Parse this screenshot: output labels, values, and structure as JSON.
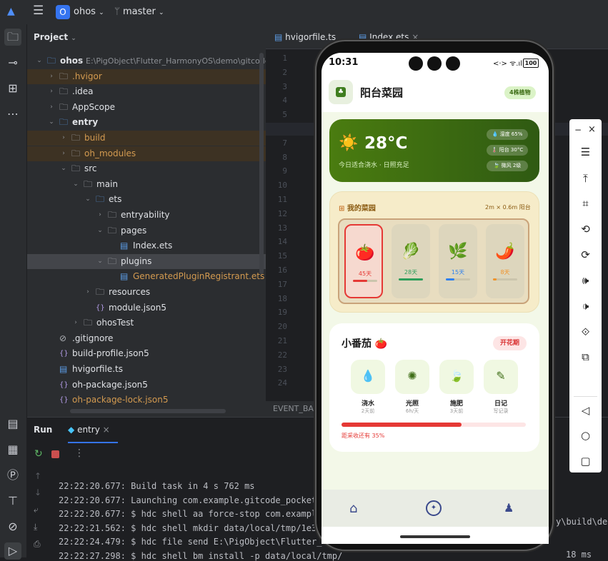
{
  "topbar": {
    "project_badge": "O",
    "project_name": "ohos",
    "branch": "master"
  },
  "project_panel": {
    "title": "Project",
    "tree": [
      {
        "label": "ohos",
        "suffix": "E:\\PigObject\\Flutter_HarmonyOS\\demo\\gitcode_p",
        "depth": 0,
        "icon": "module-folder-icon",
        "expanded": true,
        "bold": true
      },
      {
        "label": ".hvigor",
        "depth": 1,
        "icon": "folder-icon",
        "expanded": false,
        "excluded": true
      },
      {
        "label": ".idea",
        "depth": 1,
        "icon": "folder-icon",
        "expanded": false
      },
      {
        "label": "AppScope",
        "depth": 1,
        "icon": "folder-icon",
        "expanded": false
      },
      {
        "label": "entry",
        "depth": 1,
        "icon": "module-folder-icon",
        "expanded": true,
        "bold": true
      },
      {
        "label": "build",
        "depth": 2,
        "icon": "folder-icon",
        "expanded": false,
        "excluded": true
      },
      {
        "label": "oh_modules",
        "depth": 2,
        "icon": "folder-icon",
        "expanded": false,
        "excluded": true
      },
      {
        "label": "src",
        "depth": 2,
        "icon": "folder-icon",
        "expanded": true
      },
      {
        "label": "main",
        "depth": 3,
        "icon": "folder-icon",
        "expanded": true
      },
      {
        "label": "ets",
        "depth": 4,
        "icon": "source-folder-icon",
        "expanded": true
      },
      {
        "label": "entryability",
        "depth": 5,
        "icon": "folder-icon",
        "expanded": false
      },
      {
        "label": "pages",
        "depth": 5,
        "icon": "folder-icon",
        "expanded": true
      },
      {
        "label": "Index.ets",
        "depth": 6,
        "icon": "ets-file-icon",
        "leaf": true
      },
      {
        "label": "plugins",
        "depth": 5,
        "icon": "folder-icon",
        "expanded": true,
        "selected": true
      },
      {
        "label": "GeneratedPluginRegistrant.ets",
        "depth": 6,
        "icon": "ets-file-icon",
        "leaf": true,
        "orange": true
      },
      {
        "label": "resources",
        "depth": 4,
        "icon": "folder-icon",
        "expanded": false
      },
      {
        "label": "module.json5",
        "depth": 4,
        "icon": "json-file-icon",
        "leaf": true
      },
      {
        "label": "ohosTest",
        "depth": 3,
        "icon": "folder-icon",
        "expanded": false
      },
      {
        "label": ".gitignore",
        "depth": 1,
        "icon": "ignore-file-icon",
        "leaf": true
      },
      {
        "label": "build-profile.json5",
        "depth": 1,
        "icon": "json-file-icon",
        "leaf": true
      },
      {
        "label": "hvigorfile.ts",
        "depth": 1,
        "icon": "ts-file-icon",
        "leaf": true
      },
      {
        "label": "oh-package.json5",
        "depth": 1,
        "icon": "json-file-icon",
        "leaf": true
      },
      {
        "label": "oh-package-lock.json5",
        "depth": 1,
        "icon": "json-file-icon",
        "leaf": true,
        "orange": true
      }
    ]
  },
  "editor": {
    "tabs": [
      {
        "label": "hvigorfile.ts"
      },
      {
        "label": "Index.ets"
      }
    ],
    "line_numbers": [
      "1",
      "2",
      "3",
      "4",
      "5",
      "6",
      "7",
      "8",
      "9",
      "10",
      "11",
      "12",
      "13",
      "14",
      "15",
      "16",
      "17",
      "18",
      "19",
      "20",
      "21",
      "22",
      "23",
      "24"
    ],
    "bottom_tab": "EVENT_BAC"
  },
  "run_panel": {
    "title": "Run",
    "config": "entry",
    "logs": [
      "22:22:20.677: Build task in 4 s 762 ms",
      "22:22:20.677: Launching com.example.gitcode_pocket",
      "22:22:20.677: $ hdc shell aa force-stop com.exampl",
      "22:22:21.562: $ hdc shell mkdir data/local/tmp/1e3",
      "22:22:24.479: $ hdc file send E:\\PigObject\\Flutter_",
      "22:22:27.298: $ hdc shell bm install -p data/local/tmp/"
    ],
    "right_fragment": "y\\build\\defa",
    "right_fragment2": "18 ms"
  },
  "phone": {
    "status": {
      "time": "10:31",
      "signal": "<·> ᯤ.ıll",
      "battery": "100"
    },
    "app": {
      "title": "阳台菜园",
      "badge": "4株植物",
      "weather": {
        "icon": "☀️",
        "temp": "28°C",
        "subtitle": "今日适合浇水 · 日照充足",
        "chips": [
          "💧 湿度 65%",
          "🌡️ 阳台 30°C",
          "🍃 微风 2级"
        ]
      },
      "garden": {
        "title": "我的菜园",
        "size": "2m × 0.6m 阳台",
        "plots": [
          {
            "emoji": "🍅",
            "days": "45天",
            "progress": 0.6,
            "color": "#e53935",
            "selected": true
          },
          {
            "emoji": "🥬",
            "days": "28天",
            "progress": 1.0,
            "color": "#2e9e5b"
          },
          {
            "emoji": "🌿",
            "days": "15天",
            "progress": 0.35,
            "color": "#2f80ed"
          },
          {
            "emoji": "🌶️",
            "days": "8天",
            "progress": 0.15,
            "color": "#f0932b"
          }
        ]
      },
      "plant": {
        "name": "小番茄 🍅",
        "stage": "开花期",
        "actions": [
          {
            "icon": "water-drop-icon",
            "label": "浇水",
            "sub": "2天前"
          },
          {
            "icon": "sun-icon",
            "label": "光照",
            "sub": "6h/天"
          },
          {
            "icon": "leaf-icon",
            "label": "施肥",
            "sub": "3天前"
          },
          {
            "icon": "note-icon",
            "label": "日记",
            "sub": "写记录"
          }
        ],
        "progress": 0.65,
        "progress_text": "距采收还有 35%"
      }
    }
  },
  "colors": {
    "accent_green": "#3f6e17",
    "red": "#e53935",
    "badge_bg": "#dbf3c7",
    "nav_blue": "#3b4a8c"
  }
}
